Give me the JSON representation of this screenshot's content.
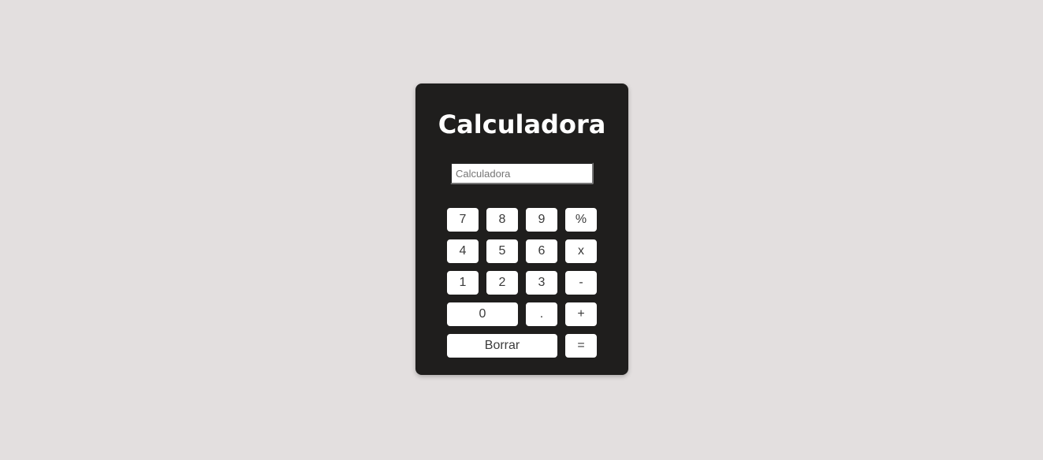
{
  "calculator": {
    "title": "Calculadora",
    "display": {
      "value": "",
      "placeholder": "Calculadora"
    },
    "keys": {
      "seven": "7",
      "eight": "8",
      "nine": "9",
      "percent": "%",
      "four": "4",
      "five": "5",
      "six": "6",
      "multiply": "x",
      "one": "1",
      "two": "2",
      "three": "3",
      "minus": "-",
      "zero": "0",
      "decimal": ".",
      "plus": "+",
      "clear": "Borrar",
      "equals": "="
    }
  },
  "colors": {
    "page_background": "#e3dfdf",
    "panel_background": "#1f1e1d",
    "key_background": "#ffffff",
    "title_text": "#ffffff"
  }
}
